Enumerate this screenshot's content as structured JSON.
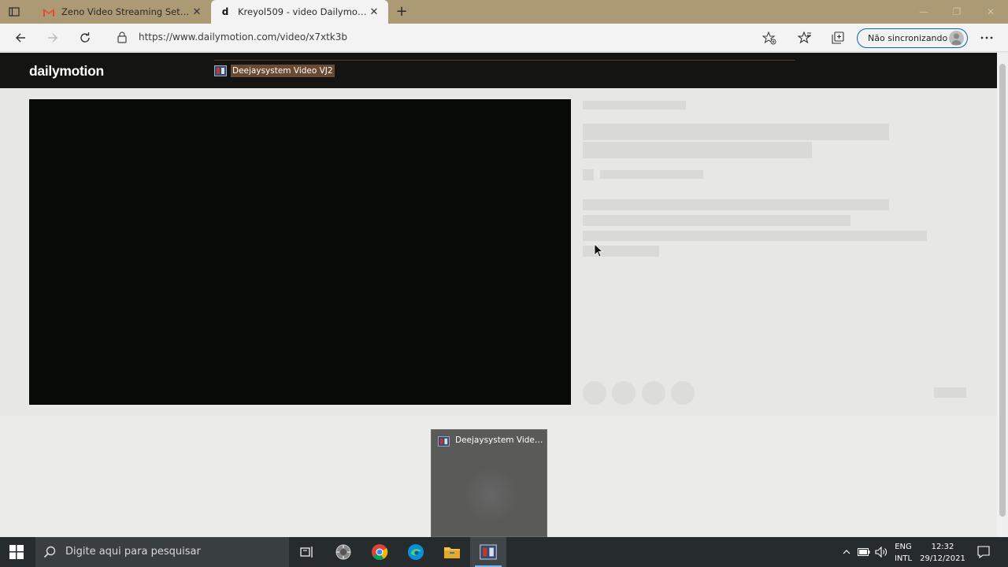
{
  "browser": {
    "tabs": [
      {
        "title": "Zeno Video Streaming Setup Gu",
        "favicon": "gmail-icon",
        "active": false
      },
      {
        "title": "Kreyol509 - video Dailymotion",
        "favicon": "d",
        "active": true
      }
    ],
    "url": "https://www.dailymotion.com/video/x7xtk3b",
    "profile_label": "Não sincronizando"
  },
  "page": {
    "logo": "dailymotion",
    "video_chip": "Deejaysystem Video VJ2"
  },
  "taskbar": {
    "search_placeholder": "Digite aqui para pesquisar",
    "preview_title": "Deejaysystem Video ...",
    "lang_line1": "ENG",
    "lang_line2": "INTL",
    "time": "12:32",
    "date": "29/12/2021"
  },
  "colors": {
    "tabstrip": "#ab9a74",
    "header": "#141413",
    "player": "#080a08",
    "accent": "#0a63b6",
    "taskbar": "#262b2e"
  }
}
